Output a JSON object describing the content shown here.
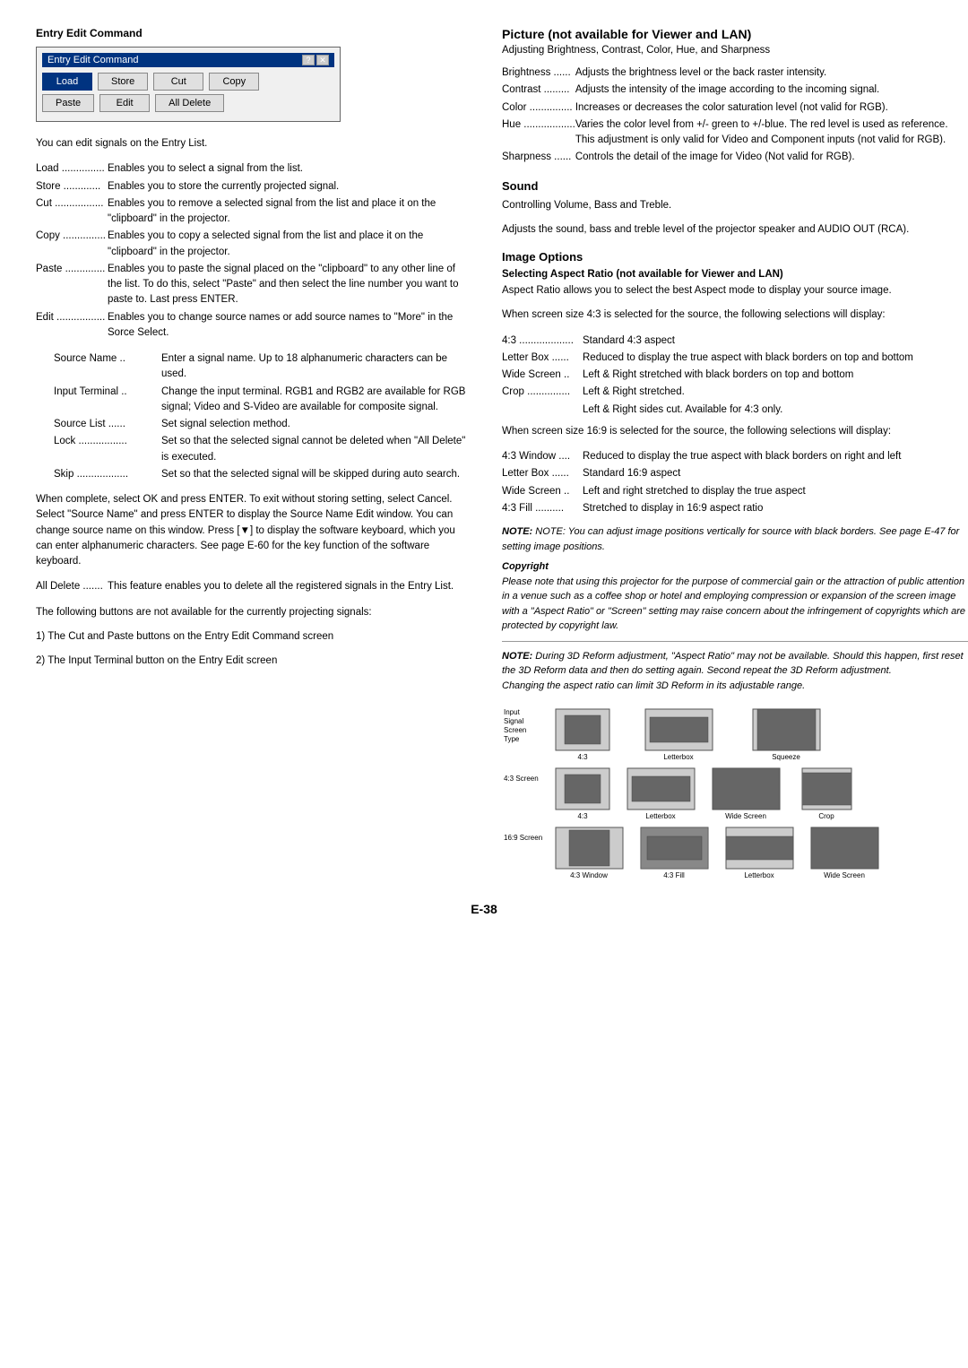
{
  "left": {
    "section_title": "Entry Edit Command",
    "dialog": {
      "title": "Entry Edit Command",
      "controls": [
        "?",
        "X"
      ],
      "row1": [
        "Load",
        "Store",
        "Cut",
        "Copy"
      ],
      "row2": [
        "Paste",
        "Edit",
        "All Delete"
      ],
      "active_btn": "Load"
    },
    "intro": "You can edit signals on the Entry List.",
    "items": [
      {
        "label": "Load",
        "dots": "...............",
        "desc": "Enables you to select a signal from the list."
      },
      {
        "label": "Store",
        "dots": ".............",
        "desc": "Enables you to store the currently projected signal."
      },
      {
        "label": "Cut",
        "dots": ".................",
        "desc": "Enables you to remove a selected signal from the list and place it on the \"clipboard\" in the projector."
      },
      {
        "label": "Copy",
        "dots": "...............",
        "desc": "Enables you to copy a selected signal from the list and place it on the \"clipboard\" in the projector."
      },
      {
        "label": "Paste",
        "dots": "..............",
        "desc": "Enables you to paste the signal placed on the \"clipboard\" to any other line of the list. To do this, select \"Paste\" and then select the line number you want to paste to. Last press ENTER."
      },
      {
        "label": "Edit",
        "dots": ".................",
        "desc": "Enables you to change source names or add source names to \"More\" in the Sorce Select."
      }
    ],
    "edit_sub_items": [
      {
        "label": "Source Name ..",
        "desc": "Enter a signal name. Up to 18 alphanumeric characters can be used."
      },
      {
        "label": "Input Terminal ..",
        "desc": "Change the input terminal. RGB1 and RGB2 are available for RGB signal; Video and S-Video are available for composite signal."
      },
      {
        "label": "Source List ......",
        "desc": "Set signal selection method."
      },
      {
        "label": "Lock .................",
        "desc": "Set so that the selected signal cannot be deleted when \"All Delete\" is executed."
      },
      {
        "label": "Skip ..................",
        "desc": "Set so that the selected signal will be skipped during auto search."
      }
    ],
    "complete_text": "When complete, select OK and press ENTER. To exit without storing setting, select Cancel. Select \"Source Name\" and press ENTER to display the Source Name Edit window. You can change source name on this window. Press [▼] to display the software keyboard, which you can enter alphanumeric characters. See page E-60 for the key function of the software keyboard.",
    "all_delete_item": {
      "label": "All Delete .......",
      "desc": "This feature enables you to delete all the registered signals in the Entry List."
    },
    "following_text": "The following buttons are not available for the currently projecting signals:",
    "bullets": [
      "1) The Cut and Paste buttons on the Entry Edit Command screen",
      "2) The Input Terminal button on the Entry Edit screen"
    ]
  },
  "right": {
    "picture_section": {
      "title": "Picture (not available for Viewer and LAN)",
      "subtitle": "Adjusting Brightness, Contrast, Color, Hue, and Sharpness",
      "items": [
        {
          "label": "Brightness ......",
          "desc": "Adjusts the brightness level or the back raster intensity."
        },
        {
          "label": "Contrast .........",
          "desc": "Adjusts the intensity of the image according to the incoming signal."
        },
        {
          "label": "Color ...............",
          "desc": "Increases or decreases the color saturation level (not valid for RGB)."
        },
        {
          "label": "Hue ..................",
          "desc": "Varies the color level from +/- green to +/-blue. The red level is used as reference. This adjustment is only valid for Video and Component inputs (not valid for RGB)."
        },
        {
          "label": "Sharpness ......",
          "desc": "Controls the detail of the image for Video (Not valid for RGB)."
        }
      ]
    },
    "sound_section": {
      "title": "Sound",
      "subtitle": "Controlling Volume, Bass and Treble.",
      "desc": "Adjusts the sound, bass and treble level of the projector speaker and AUDIO OUT (RCA)."
    },
    "image_options_section": {
      "title": "Image Options",
      "selecting_title": "Selecting Aspect Ratio (not available for Viewer and LAN)",
      "selecting_desc": "Aspect Ratio allows you to select the best Aspect mode to display your source image.",
      "when_43": "When screen size 4:3 is selected for the source, the following selections will display:",
      "items_43": [
        {
          "label": "4:3 ...................",
          "desc": "Standard 4:3 aspect"
        },
        {
          "label": "Letter Box ......",
          "desc": "Reduced to display the true aspect with black borders on top and bottom"
        },
        {
          "label": "Wide Screen ..",
          "desc": "Left & Right stretched with black borders on top and bottom"
        },
        {
          "label": "Crop ...............",
          "desc": "Left & Right stretched."
        }
      ],
      "crop_sub": "Left & Right sides cut. Available for 4:3 only.",
      "when_169": "When screen size 16:9 is selected for the source, the following selections will display:",
      "items_169": [
        {
          "label": "4:3 Window ....",
          "desc": "Reduced to display the true aspect with black borders on right and left"
        },
        {
          "label": "Letter Box ......",
          "desc": "Standard 16:9 aspect"
        },
        {
          "label": "Wide Screen ..",
          "desc": "Left and right stretched to display the true aspect"
        },
        {
          "label": "4:3 Fill ..........",
          "desc": "Stretched to display in 16:9 aspect ratio"
        }
      ],
      "note1": "NOTE: You can adjust image positions vertically for source with black borders. See page E-47 for setting image positions.",
      "copyright_title": "Copyright",
      "copyright_text": "Please note that using this projector for the purpose of commercial gain or the attraction of public attention in a venue such as a coffee shop or hotel and employing compression or expansion of the screen image with a \"Aspect Ratio\" or \"Screen\" setting may raise concern about the infringement of copyrights which are protected by copyright law.",
      "note2": "NOTE: During 3D Reform adjustment, \"Aspect Ratio\" may not be available. Should this happen, first reset the 3D Reform data and then do setting again. Second repeat the 3D Reform adjustment.",
      "note3": "Changing the aspect ratio can limit 3D Reform in its adjustable range."
    }
  },
  "page_number": "E-38"
}
